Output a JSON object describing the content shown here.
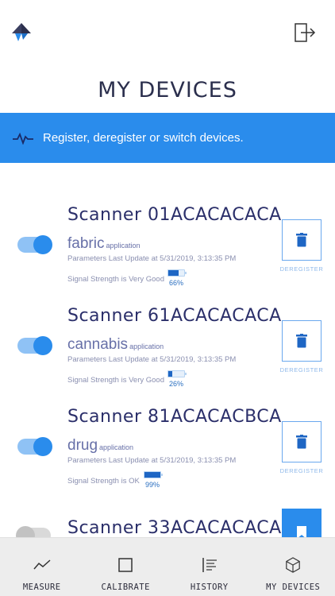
{
  "header": {
    "logo_icon": "app-logo-icon",
    "logout_icon": "logout-icon"
  },
  "page": {
    "title": "MY DEVICES"
  },
  "banner": {
    "icon": "activity-icon",
    "text": "Register, deregister or switch devices."
  },
  "devices": [
    {
      "name": "Scanner 01ACACACACA",
      "app": "fabric",
      "app_suffix": "application",
      "params": "Parameters Last Update at 5/31/2019, 3:13:35 PM",
      "signal": "Signal Strength is Very Good",
      "battery_pct": "66%",
      "battery_fraction": 0.66,
      "enabled": true,
      "deregister_label": "DEREGISTER"
    },
    {
      "name": "Scanner 61ACACACACA",
      "app": "cannabis",
      "app_suffix": "application",
      "params": "Parameters Last Update at 5/31/2019, 3:13:35 PM",
      "signal": "Signal Strength is Very Good",
      "battery_pct": "26%",
      "battery_fraction": 0.26,
      "enabled": true,
      "deregister_label": "DEREGISTER"
    },
    {
      "name": "Scanner 81ACACACBCA",
      "app": "drug",
      "app_suffix": "application",
      "params": "Parameters Last Update at 5/31/2019, 3:13:35 PM",
      "signal": "Signal Strength is OK",
      "battery_pct": "99%",
      "battery_fraction": 0.99,
      "enabled": true,
      "deregister_label": "DEREGISTER"
    },
    {
      "name": "Scanner 33ACACACACA",
      "enabled": false
    }
  ],
  "nav": {
    "measure": "MEASURE",
    "calibrate": "CALIBRATE",
    "history": "HISTORY",
    "my_devices": "MY DEVICES"
  },
  "colors": {
    "accent": "#2a8cec",
    "title": "#2b2f6a"
  }
}
